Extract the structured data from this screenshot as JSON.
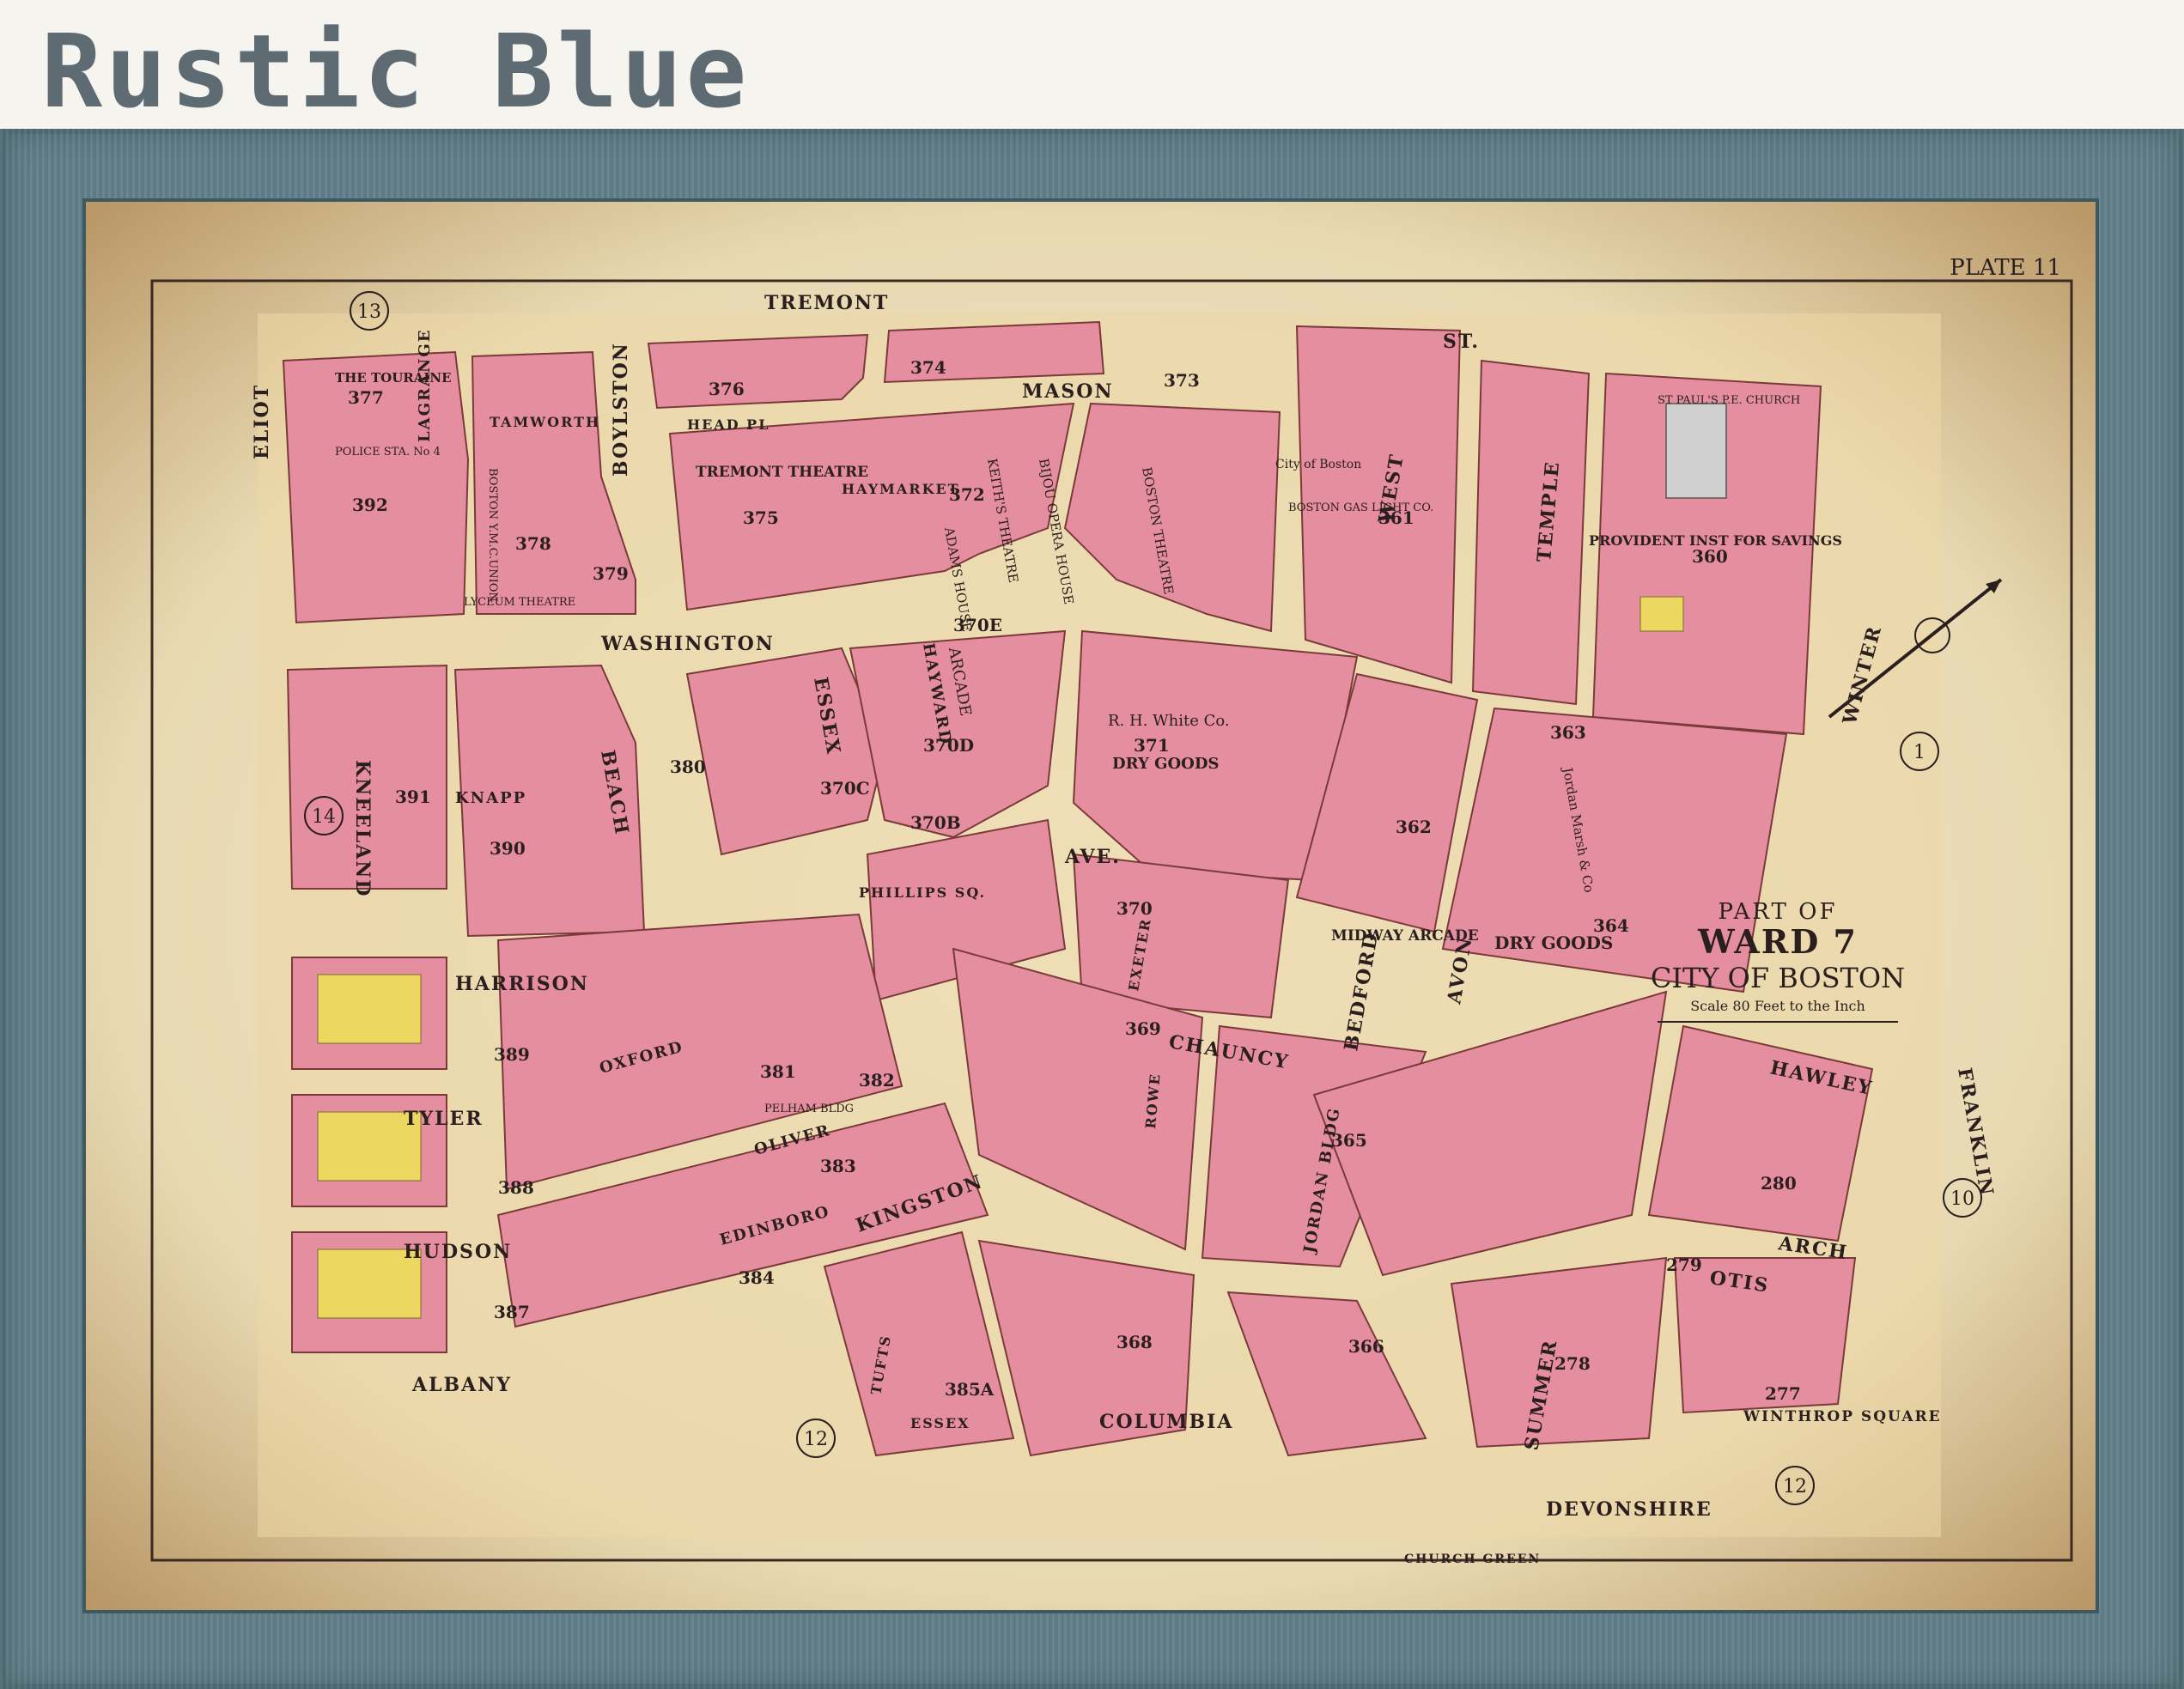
{
  "caption": "Rustic Blue",
  "map": {
    "plate": "PLATE 11",
    "title": {
      "part_of": "PART OF",
      "ward": "WARD 7",
      "city": "CITY OF BOSTON",
      "scale": "Scale 80 Feet to the Inch"
    },
    "ward_markers": [
      "13",
      "14",
      "1",
      "10",
      "12",
      "12"
    ],
    "streets": {
      "tremont": "TREMONT",
      "st_top": "ST.",
      "mason": "MASON",
      "eliot": "ELIOT",
      "lagrange": "LAGRANGE",
      "tamworth": "TAMWORTH",
      "boylston": "BOYLSTON",
      "head_pl": "HEAD PL",
      "haymarket": "HAYMARKET",
      "washington": "WASHINGTON",
      "essex": "ESSEX",
      "hayward": "HAYWARD",
      "west": "WEST",
      "temple": "TEMPLE",
      "winter": "WINTER",
      "kneeland": "KNEELAND",
      "beach": "BEACH",
      "knapp": "KNAPP",
      "ave": "AVE.",
      "phillips_sq": "PHILLIPS SQ.",
      "harrison": "HARRISON",
      "tyler": "TYLER",
      "hudson": "HUDSON",
      "albany": "ALBANY",
      "oxford": "OXFORD",
      "oliver": "OLIVER",
      "edinboro": "EDINBORO",
      "kingston": "KINGSTON",
      "tufts": "TUFTS",
      "essex_pl": "ESSEX",
      "columbia": "COLUMBIA",
      "chauncy": "CHAUNCY",
      "exeter": "EXETER",
      "rowe": "ROWE",
      "bedford": "BEDFORD",
      "avon": "AVON",
      "jordan_bldg": "JORDAN BLDG",
      "summer": "SUMMER",
      "church_green": "CHURCH GREEN",
      "devonshire": "DEVONSHIRE",
      "hawley": "HAWLEY",
      "arch": "ARCH",
      "otis": "OTIS",
      "franklin": "FRANKLIN",
      "winthrop_square": "WINTHROP SQUARE"
    },
    "buildings": {
      "touraine": "THE TOURAINE",
      "tremont_theatre": "TREMONT THEATRE",
      "boston_theatre": "BOSTON THEATRE",
      "keiths_theatre": "KEITH'S THEATRE",
      "bijou": "BIJOU OPERA HOUSE",
      "adams_house": "ADAMS HOUSE",
      "arcade": "ARCADE",
      "rh_white": "R. H. White Co.",
      "dry_goods": "DRY GOODS",
      "midway_arcade": "MIDWAY ARCADE",
      "dry_goods_2": "DRY GOODS",
      "st_pauls": "ST PAUL'S P.E. CHURCH",
      "provident": "PROVIDENT INST FOR SAVINGS",
      "lyceum": "LYCEUM THEATRE",
      "police": "POLICE STA. No 4",
      "boston_ymca": "BOSTON Y.M.C.UNION",
      "city_of_boston": "City of Boston",
      "boston_gas": "BOSTON GAS LIGHT CO.",
      "jordan_marsh": "Jordan Marsh & Co",
      "pelham": "PELHAM BLDG"
    },
    "block_numbers": [
      "377",
      "376",
      "374",
      "373",
      "392",
      "378",
      "375",
      "379",
      "372",
      "361",
      "360",
      "370E",
      "371",
      "370C",
      "370D",
      "380",
      "391",
      "363",
      "362",
      "390",
      "370B",
      "370",
      "369",
      "364",
      "389",
      "381",
      "382",
      "365",
      "388",
      "383",
      "384",
      "387",
      "385A",
      "368",
      "366",
      "278",
      "279",
      "280",
      "277"
    ]
  }
}
